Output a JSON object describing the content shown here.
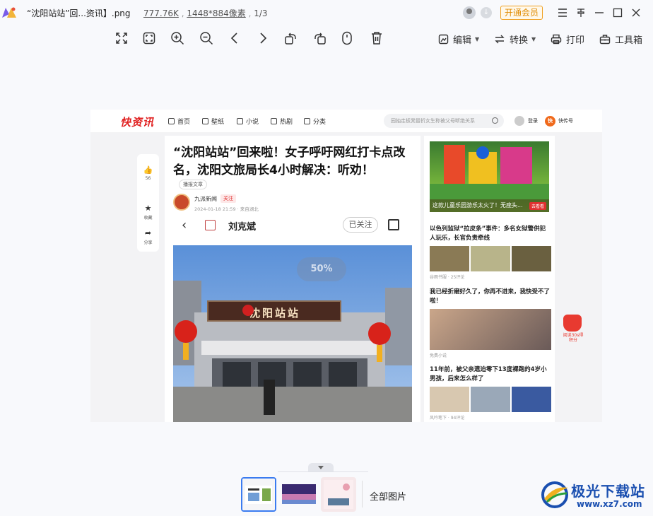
{
  "window": {
    "title": "“沈阳站站”回...资讯】.png",
    "file_size": "777.76K",
    "dimensions": "1448*884像素",
    "position": "1/3",
    "vip_label": "开通会员"
  },
  "toolbar": {
    "edit_label": "编辑",
    "convert_label": "转换",
    "print_label": "打印",
    "toolbox_label": "工具箱"
  },
  "site": {
    "logo": "快资讯",
    "nav": [
      "首页",
      "壁纸",
      "小说",
      "热剧",
      "分类"
    ],
    "search_placeholder": "园抽走板凳替折女生称被父母断绝关系",
    "login": "登录",
    "kuaichuan": "快传号"
  },
  "side_actions": {
    "like_count": "56",
    "collect": "收藏",
    "share": "分享"
  },
  "article": {
    "title": "“沈阳站站”回来啦！女子呼吁网红打卡点改名，沈阳文旅局长4小时解决：听劝！",
    "listen": "播报文章",
    "author": "九派新闻",
    "follow": "关注",
    "time": "2024-01-18 21:59 · 来自湖北",
    "inner_author": "刘克斌",
    "followed": "已关注",
    "percent": "50%",
    "sign_text": "沈阳站站"
  },
  "sidebar_news": [
    {
      "title": "这款儿童乐园游乐太火了！无座头...",
      "tag": "去看看"
    },
    {
      "title": "以色列监狱“拉皮条”事件：多名女狱警供犯人玩乐，长官负责牵线",
      "meta": "谷雨书服 · 25评论"
    },
    {
      "title": "我已经折磨好久了，你再不进来，我快受不了啦！",
      "meta": "免费小说"
    },
    {
      "title": "11年前，被父亲遗迫零下13度裸跑的4岁小男孩，后来怎么样了",
      "meta": "风吟笔下 · 94评论"
    }
  ],
  "float_ad": "阅读30s得积分",
  "bottom": {
    "all_images": "全部图片"
  },
  "watermark": {
    "title": "极光下载站",
    "url": "www.xz7.com"
  }
}
